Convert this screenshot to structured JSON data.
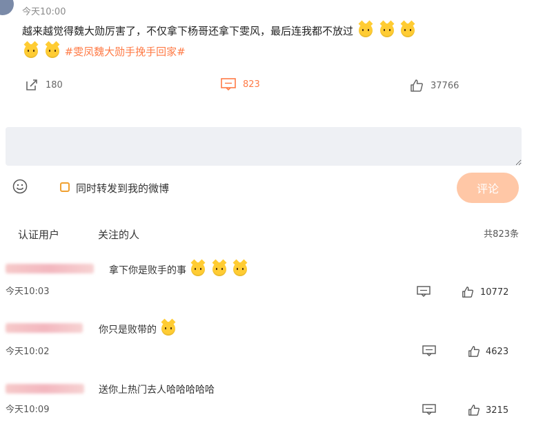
{
  "post": {
    "time": "今天10:00",
    "text_line1": "越来越觉得魏大勋厉害了，不仅拿下杨哥还拿下雯风，最后连我都不放过",
    "hashtag": "#雯凤魏大勋手挽手回家#",
    "actions": {
      "repost_count": "180",
      "comment_count": "823",
      "like_count": "37766"
    }
  },
  "composer": {
    "placeholder": "",
    "repost_label": "同时转发到我的微博",
    "submit_label": "评论"
  },
  "tabs": {
    "verified": "认证用户",
    "following": "关注的人",
    "total": "共823条"
  },
  "comments": [
    {
      "text": "拿下你是败手的事",
      "time": "今天10:03",
      "likes": "10772"
    },
    {
      "text": "你只是败带的",
      "time": "今天10:02",
      "likes": "4623"
    },
    {
      "text": "送你上热门去人哈哈哈哈哈",
      "time": "今天10:09",
      "likes": "3215"
    }
  ],
  "colors": {
    "accent": "#ff7a45",
    "submit_bg": "#ffc7a6",
    "input_bg": "#eef0f4"
  },
  "icons": [
    "emoji-face-icon",
    "repost-icon",
    "comment-icon",
    "like-icon",
    "cat-emoji-icon"
  ]
}
